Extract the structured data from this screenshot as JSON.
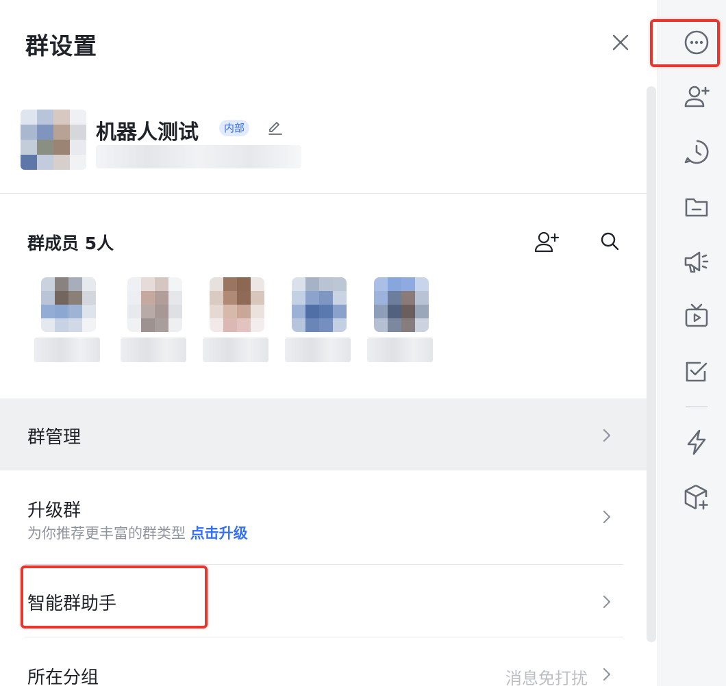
{
  "panel": {
    "title": "群设置",
    "close_icon": "close-icon"
  },
  "group": {
    "name": "机器人测试",
    "tag": "内部",
    "edit_icon": "edit-pencil-icon"
  },
  "members": {
    "title": "群成员 5人",
    "add_icon": "add-member-icon",
    "search_icon": "search-icon",
    "count": 5
  },
  "settings": {
    "group_manage": {
      "label": "群管理"
    },
    "upgrade": {
      "label": "升级群",
      "sub": "为你推荐更丰富的群类型",
      "link": "点击升级"
    },
    "assistant": {
      "label": "智能群助手"
    },
    "folder": {
      "label": "所在分组",
      "value": "消息免打扰"
    }
  },
  "toolbar": {
    "icons": [
      "more-icon",
      "add-member-icon",
      "history-clock-icon",
      "folder-icon",
      "announcement-icon",
      "live-tv-icon",
      "todo-check-icon",
      "lightning-icon",
      "app-box-add-icon"
    ]
  },
  "colors": {
    "accent": "#3370ff",
    "annotation": "#e6372e",
    "hover_row": "#eff0f1"
  }
}
